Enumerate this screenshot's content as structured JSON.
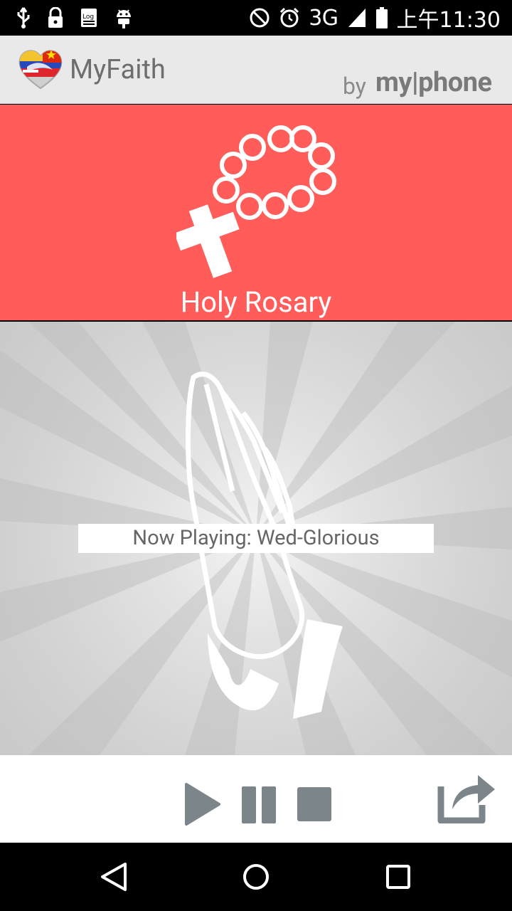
{
  "status_bar": {
    "left_icons": [
      "usb-icon",
      "lock-icon",
      "log-icon",
      "android-icon"
    ],
    "right_icons": [
      "do-not-disturb-icon",
      "alarm-icon",
      "signal-icon",
      "battery-icon"
    ],
    "network": "3G",
    "time": "上午11:30"
  },
  "app_bar": {
    "title": "MyFaith",
    "by": "by",
    "brand": "my|phone"
  },
  "rosary": {
    "label": "Holy Rosary",
    "background_color": "#ff5c5a"
  },
  "player": {
    "now_playing": "Now Playing: Wed-Glorious"
  },
  "controls": {
    "icon_color": "#7b858a",
    "buttons": [
      "play-icon",
      "pause-icon",
      "stop-icon",
      "share-icon"
    ]
  },
  "nav_bar": {
    "buttons": [
      "back-icon",
      "home-icon",
      "recents-icon"
    ]
  }
}
